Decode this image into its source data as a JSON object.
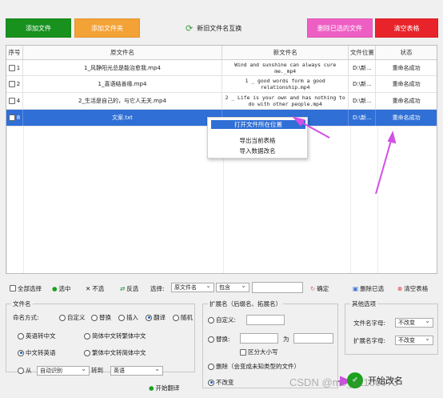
{
  "top_buttons": {
    "add_file": "添加文件",
    "add_folder": "添加文件夹",
    "swap": "新旧文件名互换",
    "delete_selected": "删除已选的文件",
    "clear_table": "清空表格"
  },
  "table": {
    "headers": [
      "序号",
      "原文件名",
      "新文件名",
      "文件位置",
      "状态"
    ],
    "rows": [
      {
        "num": "1",
        "orig": "1_风静阳光总是能治愈我.mp4",
        "new": "Wind and sunshine can always cure me._mp4",
        "loc": "D:\\新...",
        "status": "重命名成功"
      },
      {
        "num": "2",
        "orig": "1_喜语结善缘.mp4",
        "new": "1 _ good words form a good relationship.mp4",
        "loc": "D:\\新...",
        "status": "重命名成功"
      },
      {
        "num": "4",
        "orig": "2_生活是自己的，与它人无关.mp4",
        "new": "2 _ Life is your own and has nothing to do with other people.mp4",
        "loc": "D:\\新...",
        "status": "重命名成功"
      },
      {
        "num": "8",
        "orig": "文案.txt",
        "new": "",
        "loc": "D:\\新...",
        "status": "重命名成功"
      }
    ]
  },
  "context_menu": {
    "open_location": "打开文件所在位置",
    "export_table": "导出当前表格",
    "import_rename": "导入数据改名"
  },
  "toolbar": {
    "select_all": "全部选择",
    "select": "选中",
    "deselect": "不选",
    "invert": "反选",
    "choose_label": "选择:",
    "choose_value": "原文件名",
    "contains": "包含",
    "confirm": "确定",
    "delete_selected": "删除已选",
    "clear_table": "清空表格"
  },
  "filename_panel": {
    "title": "文件名",
    "method_label": "命名方式:",
    "methods": [
      "自定义",
      "替换",
      "插入",
      "翻译",
      "随机"
    ],
    "opt_en_zh": "英语转中文",
    "opt_simp_trad": "简体中文转繁体中文",
    "opt_zh_en": "中文转英语",
    "opt_trad_simp": "繁体中文转简体中文",
    "from_label": "从",
    "from_value": "自动识别",
    "to_label": "转到",
    "to_value": "英语",
    "start_translate": "开始翻译"
  },
  "ext_panel": {
    "title": "扩展名（后缀名、拓展名）",
    "custom": "自定义:",
    "replace": "替换:",
    "as": "为",
    "case": "区分大小写",
    "delete": "删除（会变成未知类型的文件）",
    "unchanged": "不改变"
  },
  "other_panel": {
    "title": "其他选项",
    "char_label1": "文件名字母:",
    "char_value1": "不改变",
    "char_label2": "扩展名字母:",
    "char_value2": "不改变"
  },
  "start_button": "开始改名",
  "watermark": "CSDN @m0_61166673",
  "colors": {
    "green": "#18911f",
    "orange": "#f3a236",
    "pink": "#ee5fc4",
    "red": "#e8232a",
    "selection": "#2f6fd6",
    "arrow": "#d34fe6"
  }
}
